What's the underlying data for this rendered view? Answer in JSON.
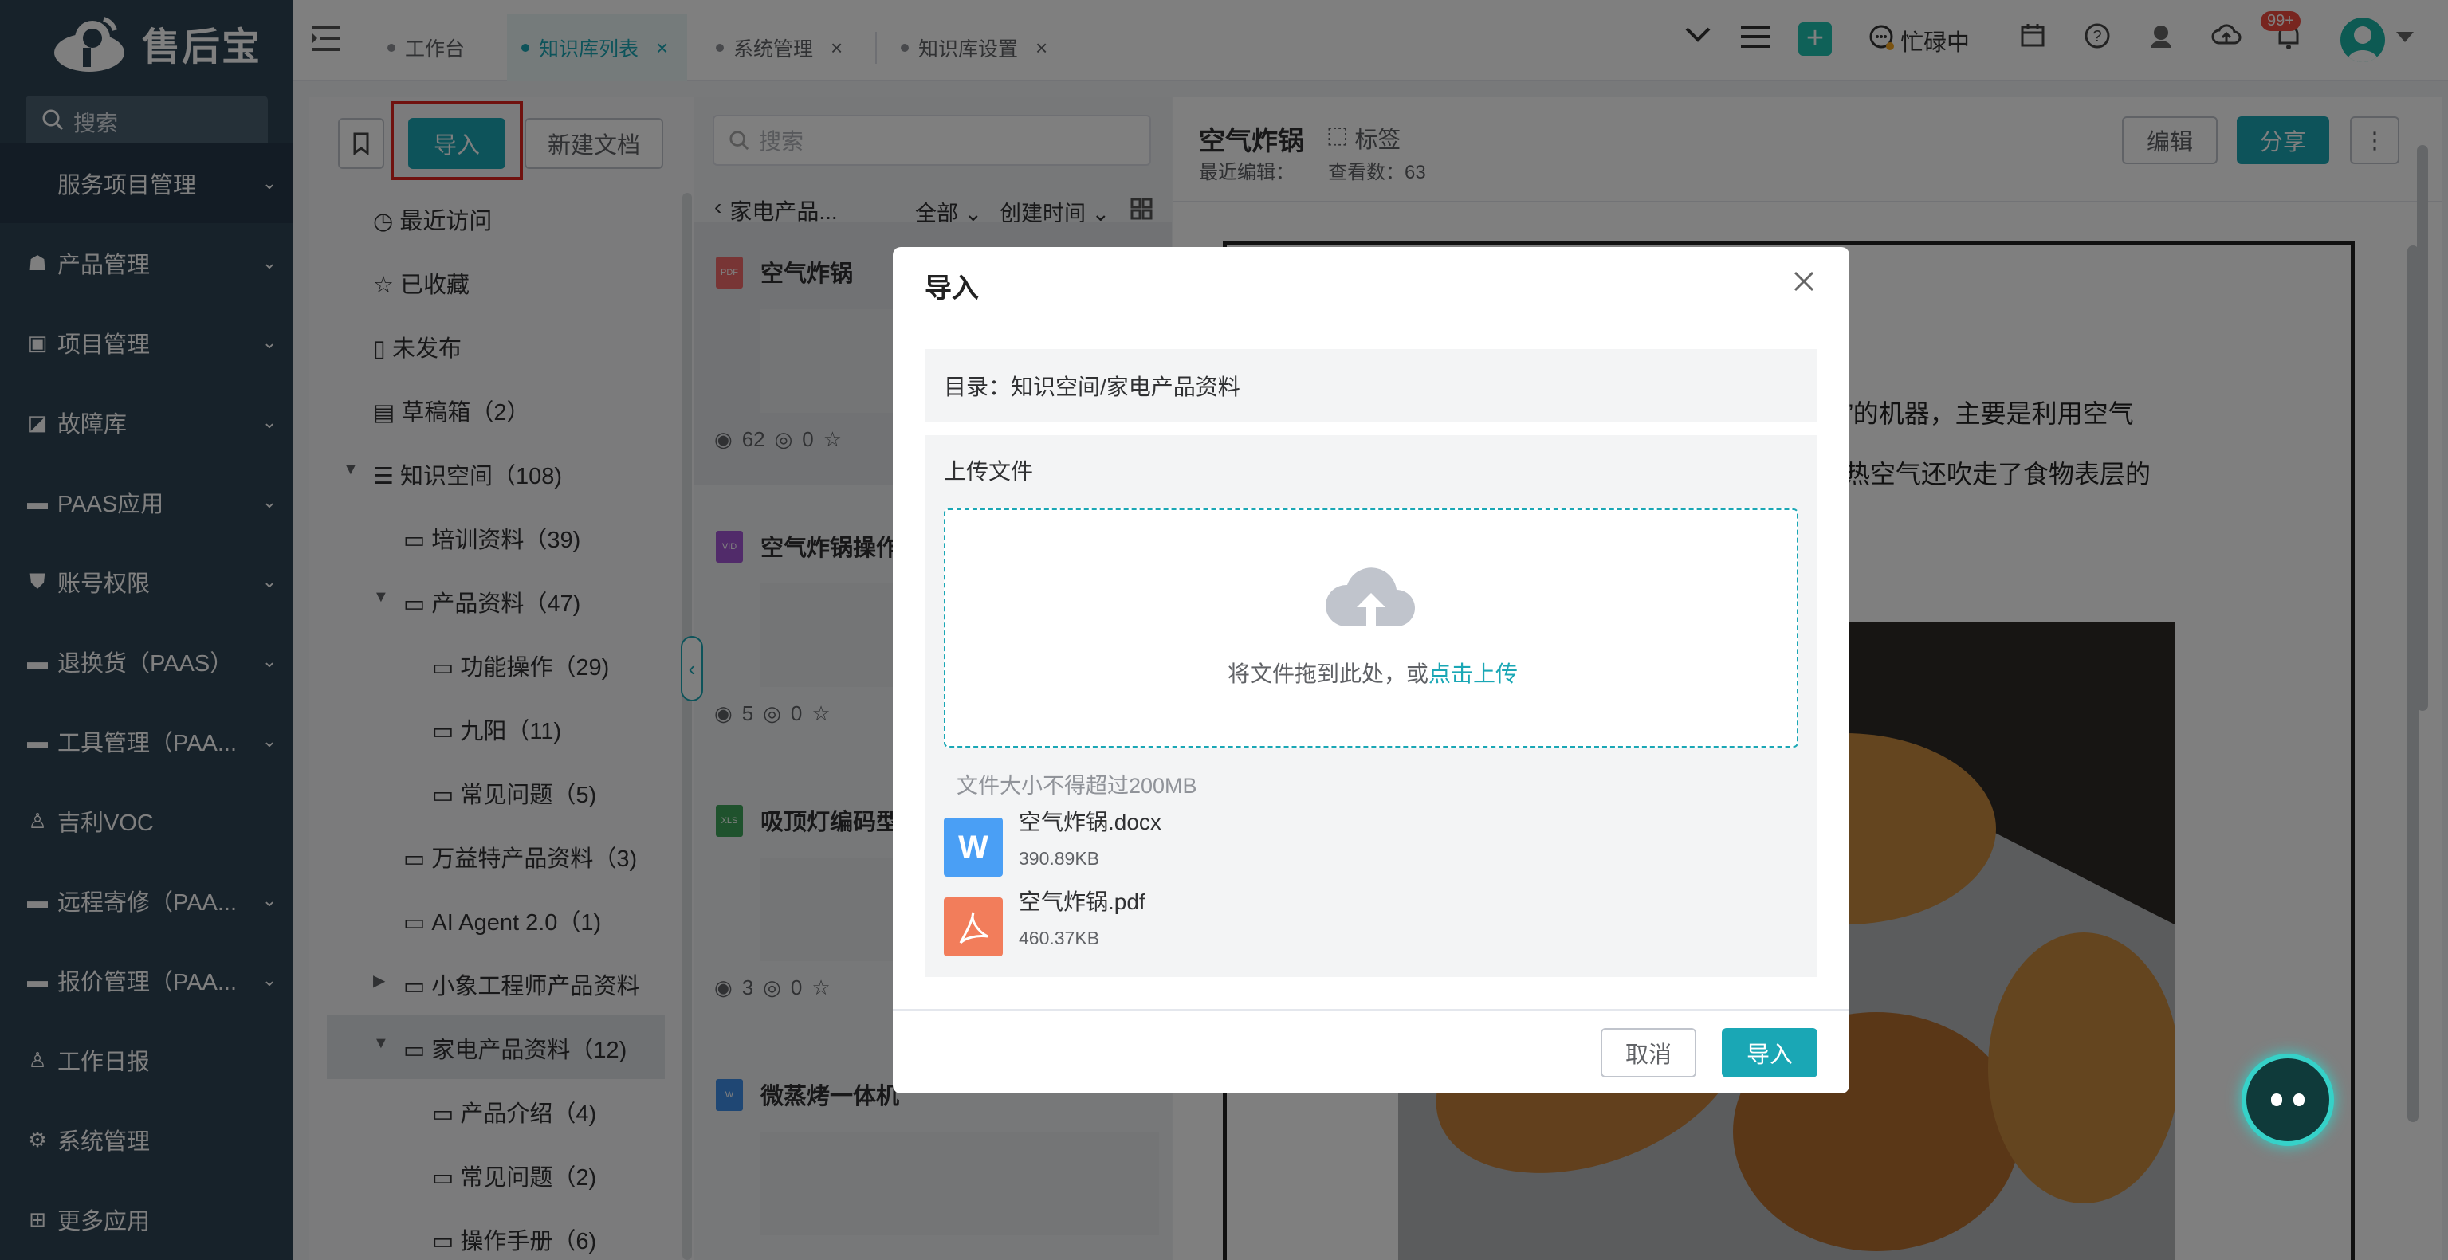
{
  "sidebar": {
    "brand": "售后宝",
    "search_placeholder": "搜索",
    "items": [
      {
        "label": "服务项目管理",
        "icon": "",
        "name": "service-project"
      },
      {
        "label": "产品管理",
        "icon": "☗",
        "name": "product"
      },
      {
        "label": "项目管理",
        "icon": "▣",
        "name": "project"
      },
      {
        "label": "故障库",
        "icon": "◪",
        "name": "fault-library"
      },
      {
        "label": "PAAS应用",
        "icon": "▬",
        "name": "paas-app"
      },
      {
        "label": "账号权限",
        "icon": "⛊",
        "name": "account"
      },
      {
        "label": "退换货（PAAS）",
        "icon": "▬",
        "name": "returns"
      },
      {
        "label": "工具管理（PAA...",
        "icon": "▬",
        "name": "tools"
      },
      {
        "label": "吉利VOC",
        "icon": "♙",
        "name": "geely-voc"
      },
      {
        "label": "远程寄修（PAA...",
        "icon": "▬",
        "name": "remote-repair"
      },
      {
        "label": "报价管理（PAA...",
        "icon": "▬",
        "name": "quote"
      },
      {
        "label": "工作日报",
        "icon": "♙",
        "name": "daily-report"
      },
      {
        "label": "系统管理",
        "icon": "⚙",
        "name": "system"
      },
      {
        "label": "更多应用",
        "icon": "⊞",
        "name": "more-apps"
      }
    ]
  },
  "tabs": [
    {
      "label": "工作台",
      "active": false,
      "closable": false
    },
    {
      "label": "知识库列表",
      "active": true,
      "closable": true
    },
    {
      "label": "系统管理",
      "active": false,
      "closable": true
    },
    {
      "label": "知识库设置",
      "active": false,
      "closable": true
    }
  ],
  "topbar": {
    "status": "忙碌中",
    "badge": "99+"
  },
  "left": {
    "import_btn": "导入",
    "new_doc_btn": "新建文档",
    "tree": [
      {
        "label": "最近访问",
        "icon": "◷",
        "indent": 0,
        "arrow": ""
      },
      {
        "label": "已收藏",
        "icon": "☆",
        "indent": 0,
        "arrow": ""
      },
      {
        "label": "未发布",
        "icon": "▯",
        "indent": 0,
        "arrow": ""
      },
      {
        "label": "草稿箱（2）",
        "icon": "▤",
        "indent": 0,
        "arrow": ""
      },
      {
        "label": "知识空间（108)",
        "icon": "☰",
        "indent": 0,
        "arrow": "▼"
      },
      {
        "label": "培训资料（39)",
        "icon": "▭",
        "indent": 1,
        "arrow": ""
      },
      {
        "label": "产品资料（47)",
        "icon": "▭",
        "indent": 1,
        "arrow": "▼"
      },
      {
        "label": "功能操作（29)",
        "icon": "▭",
        "indent": 2,
        "arrow": ""
      },
      {
        "label": "九阳（11)",
        "icon": "▭",
        "indent": 2,
        "arrow": ""
      },
      {
        "label": "常见问题（5)",
        "icon": "▭",
        "indent": 2,
        "arrow": ""
      },
      {
        "label": "万益特产品资料（3)",
        "icon": "▭",
        "indent": 1,
        "arrow": ""
      },
      {
        "label": "AI Agent 2.0（1)",
        "icon": "▭",
        "indent": 1,
        "arrow": ""
      },
      {
        "label": "小象工程师产品资料",
        "icon": "▭",
        "indent": 1,
        "arrow": "▶"
      },
      {
        "label": "家电产品资料（12)",
        "icon": "▭",
        "indent": 1,
        "arrow": "▼",
        "selected": true
      },
      {
        "label": "产品介绍（4)",
        "icon": "▭",
        "indent": 2,
        "arrow": ""
      },
      {
        "label": "常见问题（2)",
        "icon": "▭",
        "indent": 2,
        "arrow": ""
      },
      {
        "label": "操作手册（6)",
        "icon": "▭",
        "indent": 2,
        "arrow": ""
      }
    ]
  },
  "middle": {
    "search_placeholder": "搜索",
    "breadcrumb": "家电产品...",
    "filter_all": "全部",
    "sort": "创建时间",
    "docs": [
      {
        "title": "空气炸锅",
        "type": "PDF",
        "views": "62",
        "comments": "0"
      },
      {
        "title": "空气炸锅操作",
        "type": "VID",
        "views": "5",
        "comments": "0"
      },
      {
        "title": "吸顶灯编码型",
        "type": "XLS",
        "views": "3",
        "comments": "0"
      },
      {
        "title": "微蒸烤一体机",
        "type": "W",
        "views": "",
        "comments": ""
      }
    ]
  },
  "right": {
    "title": "空气炸锅",
    "tag": "标签",
    "last_edit": "最近编辑：",
    "view_count": "查看数：63",
    "edit_btn": "编辑",
    "share_btn": "分享",
    "body_line1": "炸”的机器，主要是利用空气",
    "body_line2": "时热空气还吹走了食物表层的"
  },
  "modal": {
    "title": "导入",
    "directory": "目录：知识空间/家电产品资料",
    "upload_label": "上传文件",
    "drop_text": "将文件拖到此处，或",
    "click_upload": "点击上传",
    "size_hint": "文件大小不得超过200MB",
    "files": [
      {
        "name": "空气炸锅.docx",
        "size": "390.89KB",
        "type": "W",
        "color": "#4a9ff5"
      },
      {
        "name": "空气炸锅.pdf",
        "size": "460.37KB",
        "type": "pdf",
        "color": "#f27d5b"
      }
    ],
    "cancel": "取消",
    "confirm": "导入"
  }
}
